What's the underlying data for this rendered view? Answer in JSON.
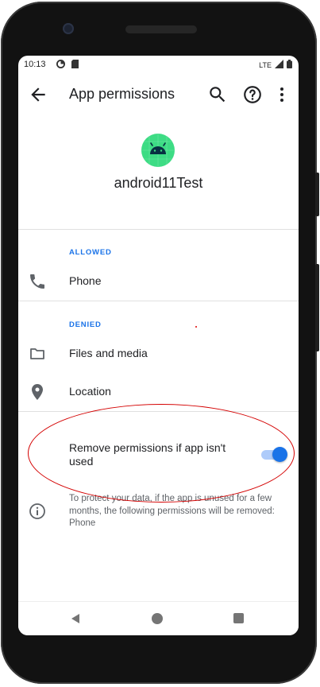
{
  "status_bar": {
    "time": "10:13",
    "network": "LTE"
  },
  "toolbar": {
    "title": "App permissions"
  },
  "app": {
    "name": "android11Test"
  },
  "sections": {
    "allowed_header": "ALLOWED",
    "allowed_items": [
      {
        "label": "Phone",
        "icon": "phone-icon"
      }
    ],
    "denied_header": "DENIED",
    "denied_items": [
      {
        "label": "Files and media",
        "icon": "folder-icon"
      },
      {
        "label": "Location",
        "icon": "location-pin-icon"
      }
    ]
  },
  "auto_revoke": {
    "label": "Remove permissions if app isn't used",
    "enabled": true
  },
  "info": {
    "text": "To protect your data, if the app is unused for a few months, the following permissions will be removed: Phone"
  },
  "colors": {
    "accent": "#1a73e8",
    "app_icon_bg": "#3ddc84",
    "annotation": "#d40000"
  }
}
